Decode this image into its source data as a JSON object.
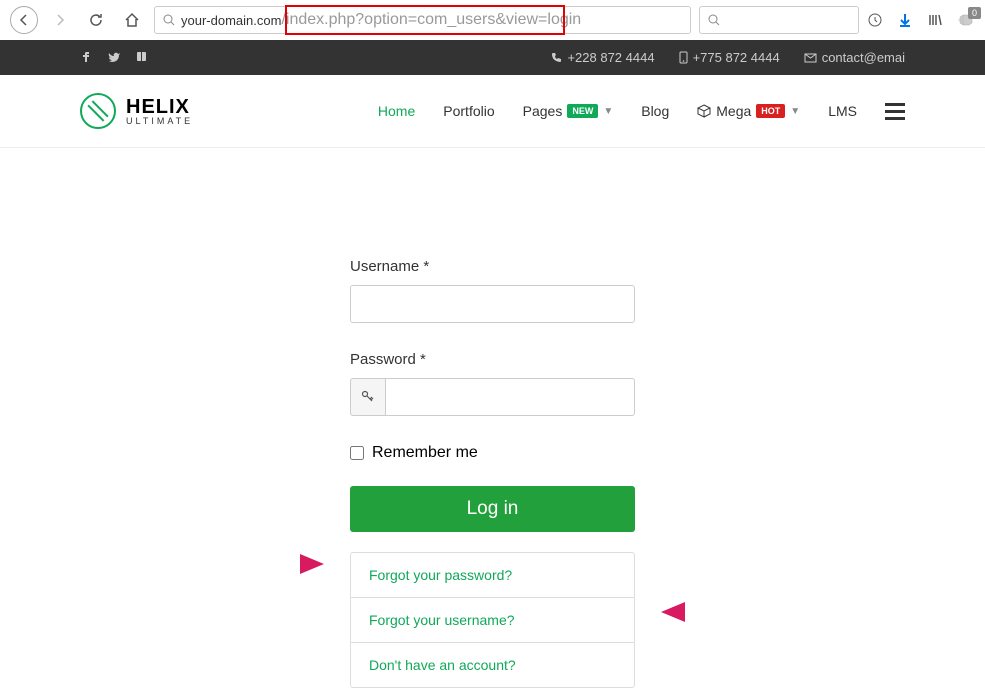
{
  "url": {
    "domain": "your-domain.com",
    "path": "/index.php?option=com_users&view=login"
  },
  "topbar": {
    "phone1": "+228 872 4444",
    "phone2": "+775 872 4444",
    "email": "contact@emai"
  },
  "logo": {
    "brand": "HELIX",
    "sub": "ULTIMATE"
  },
  "nav": {
    "home": "Home",
    "portfolio": "Portfolio",
    "pages": "Pages",
    "pages_badge": "NEW",
    "blog": "Blog",
    "mega": "Mega",
    "mega_badge": "HOT",
    "lms": "LMS"
  },
  "form": {
    "username_label": "Username *",
    "password_label": "Password *",
    "remember_label": "Remember me",
    "login_btn": "Log in",
    "forgot_password": "Forgot your password?",
    "forgot_username": "Forgot your username?",
    "no_account": "Don't have an account?"
  },
  "notif_count": "0"
}
